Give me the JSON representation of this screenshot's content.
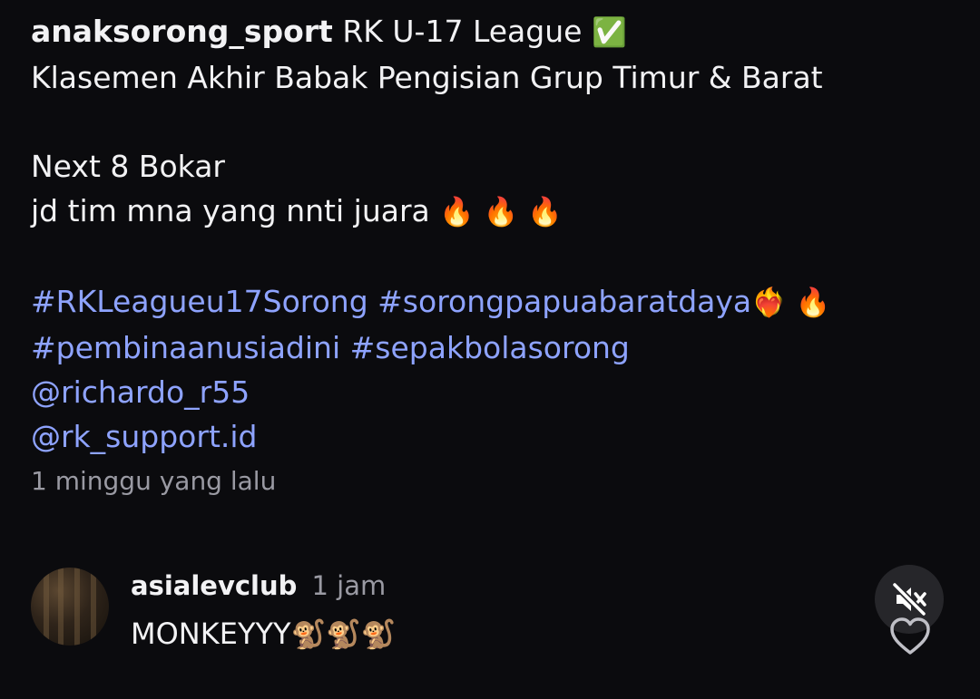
{
  "caption": {
    "username": "anaksorong_sport",
    "title_text": "RK U-17 League",
    "title_emoji": "✅",
    "line2": "Klasemen Akhir Babak Pengisian Grup Timur & Barat",
    "line3": "Next 8 Bokar",
    "line4_text": "jd tim mna yang nnti juara",
    "line4_emoji": "🔥 🔥 🔥",
    "hashtag1": "#RKLeagueu17Sorong",
    "hashtag2": "#sorongpapuabaratdaya",
    "hashtag2_emoji": "❤️‍🔥 🔥",
    "hashtag3": "#pembinaanusiadini",
    "hashtag4": "#sepakbolasorong",
    "mention1": "@richardo_r55",
    "mention2": "@rk_support.id"
  },
  "timestamp": "1 minggu yang lalu",
  "comment": {
    "username": "asialevclub",
    "time": "1 jam",
    "text": "MONKEYYY",
    "emoji": "🐒🐒🐒"
  },
  "controls": {
    "mute_icon": "speaker-muted-icon",
    "like_icon": "heart-outline-icon"
  },
  "colors": {
    "background": "#0b0b0e",
    "link": "#8ea3ff",
    "muted_text": "#9a9aa3"
  }
}
